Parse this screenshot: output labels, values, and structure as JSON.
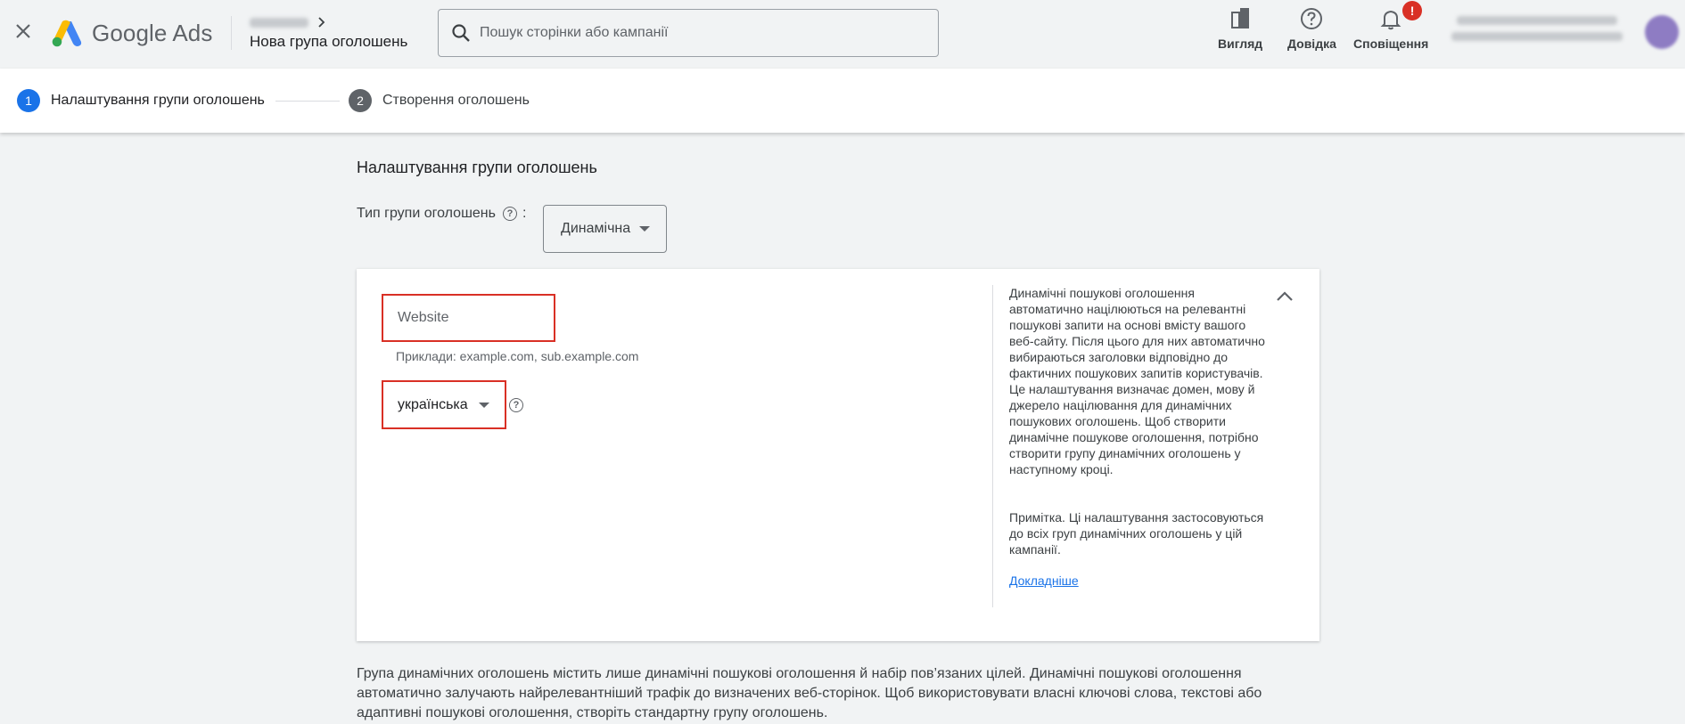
{
  "header": {
    "logo_text": "Google Ads",
    "breadcrumb_title": "Нова група оголошень",
    "search_placeholder": "Пошук сторінки або кампанії",
    "actions": {
      "view_label": "Вигляд",
      "help_label": "Довідка",
      "notifications_label": "Сповіщення",
      "notifications_badge": "!"
    }
  },
  "stepper": {
    "steps": [
      {
        "number": "1",
        "label": "Налаштування групи оголошень",
        "active": true
      },
      {
        "number": "2",
        "label": "Створення оголошень",
        "active": false
      }
    ]
  },
  "main": {
    "section_title": "Налаштування групи оголошень",
    "type_label": "Тип групи оголошень",
    "type_colon": ":",
    "type_value": "Динамічна",
    "website_placeholder": "Website",
    "website_hint": "Приклади: example.com, sub.example.com",
    "language_value": "українська",
    "info_text": "Динамічні пошукові оголошення автоматично націлюються на релевантні пошукові запити на основі вмісту вашого веб-сайту. Після цього для них автоматично вибираються заголовки відповідно до фактичних пошукових запитів користувачів. Це налаштування визначає домен, мову й джерело націлювання для динамічних пошукових оголошень. Щоб створити динамічне пошукове оголошення, потрібно створити групу динамічних оголошень у наступному кроці.",
    "info_note": "Примітка. Ці налаштування застосовуються до всіх груп динамічних оголошень у цій кампанії.",
    "info_link": "Докладніше",
    "bottom_text": "Група динамічних оголошень містить лише динамічні пошукові оголошення й набір пов’язаних цілей. Динамічні пошукові оголошення автоматично залучають найрелевантніший трафік до визначених веб-сторінок. Щоб використовувати власні ключові слова, текстові або адаптивні пошукові оголошення, створіть стандартну групу оголошень."
  },
  "colors": {
    "accent_blue": "#1a73e8",
    "highlight_red": "#d93025",
    "step_inactive": "#5f6368"
  },
  "icons": {
    "close": "close-icon",
    "search": "search-icon",
    "view": "view-icon",
    "help": "help-icon",
    "notifications": "bell-icon",
    "collapse": "chevron-up-icon"
  }
}
